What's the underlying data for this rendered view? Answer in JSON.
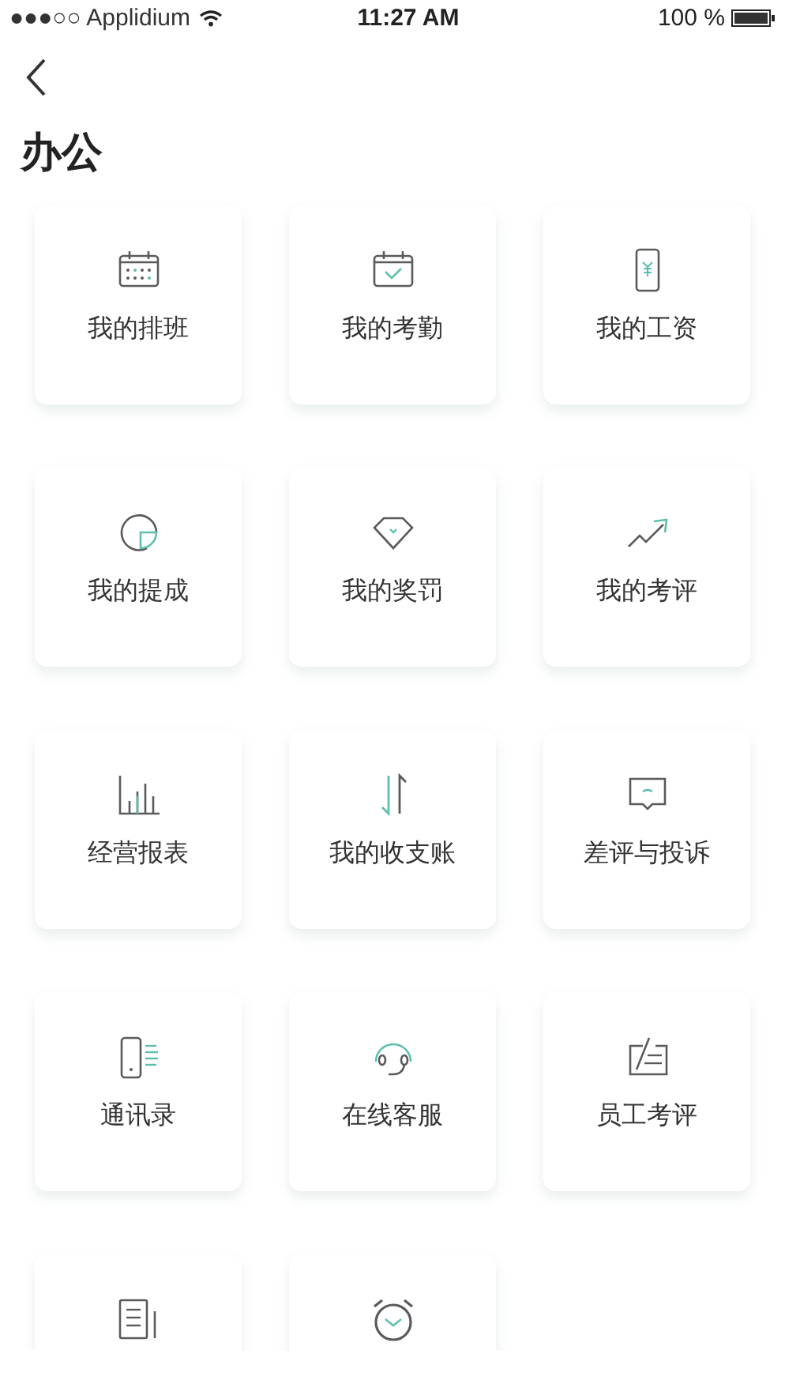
{
  "status_bar": {
    "carrier": "●●●○○ Applidium",
    "time": "11:27 AM",
    "battery": "100 %"
  },
  "header": {
    "title": "办公"
  },
  "tiles": [
    {
      "kind": "full",
      "label": "我的排班"
    },
    {
      "kind": "full",
      "label": "我的考勤"
    },
    {
      "kind": "full",
      "label": "我的工资"
    },
    {
      "kind": "full",
      "label": "我的提成"
    },
    {
      "kind": "full",
      "label": "我的奖罚"
    },
    {
      "kind": "full",
      "label": "我的考评"
    },
    {
      "kind": "full",
      "label": "经营报表"
    },
    {
      "kind": "full",
      "label": "我的收支账"
    },
    {
      "kind": "full",
      "label": "差评与投诉"
    },
    {
      "kind": "full",
      "label": "通讯录"
    },
    {
      "kind": "full",
      "label": "在线客服"
    },
    {
      "kind": "full",
      "label": "员工考评"
    },
    {
      "kind": "cut_off"
    },
    {
      "kind": "cut_off"
    }
  ]
}
